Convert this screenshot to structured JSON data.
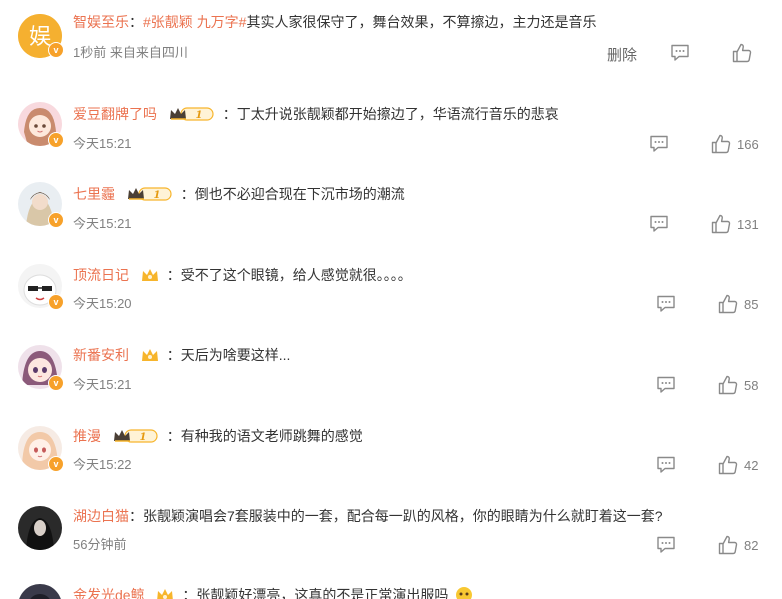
{
  "top_comment": {
    "user": "智娱至乐",
    "separator": "：",
    "tag1": "#张靓颖",
    "tag2": "九万字#",
    "text": "其实人家很保守了，舞台效果，不算擦边，主力还是音乐",
    "time": "1秒前",
    "source": "来自来自四川",
    "delete_label": "删除",
    "avatar_char": "娱"
  },
  "comments": [
    {
      "user": "爱豆翻牌了吗",
      "vip": "big",
      "vip_level": "1",
      "text": "丁太升说张靓颖都开始擦边了，华语流行音乐的悲哀",
      "time": "今天15:21",
      "likes": "166"
    },
    {
      "user": "七里霾",
      "vip": "big",
      "vip_level": "1",
      "text": "倒也不必迎合现在下沉市场的潮流",
      "time": "今天15:21",
      "likes": "131"
    },
    {
      "user": "顶流日记",
      "vip": "small",
      "vip_level": "",
      "text": "受不了这个眼镜，给人感觉就很。。。。",
      "time": "今天15:20",
      "likes": "85"
    },
    {
      "user": "新番安利",
      "vip": "small",
      "vip_level": "",
      "text": "天后为啥要这样...",
      "time": "今天15:21",
      "likes": "58"
    },
    {
      "user": "推漫",
      "vip": "big",
      "vip_level": "1",
      "text": "有种我的语文老师跳舞的感觉",
      "time": "今天15:22",
      "likes": "42"
    },
    {
      "user": "湖边白猫",
      "vip": "none",
      "vip_level": "",
      "text": "张靓颖演唱会7套服装中的一套，配合每一趴的风格，你的眼睛为什么就盯着这一套?",
      "time": "56分钟前",
      "likes": "82"
    },
    {
      "user": "金发光de鲸",
      "vip": "small",
      "vip_level": "",
      "text": "张靓颖好漂亮，这真的不是正常演出服吗",
      "time": "",
      "likes": ""
    }
  ],
  "colon": "：",
  "colors": {
    "username": "#eb7350",
    "text": "#333333",
    "meta": "#808080",
    "icon": "#8a8a8a",
    "vip_gold": "#f7b52c"
  },
  "icons": {
    "comment": "comment-icon",
    "like": "thumbs-up-icon",
    "vip": "crown-icon",
    "verified": "verified-v-icon"
  }
}
